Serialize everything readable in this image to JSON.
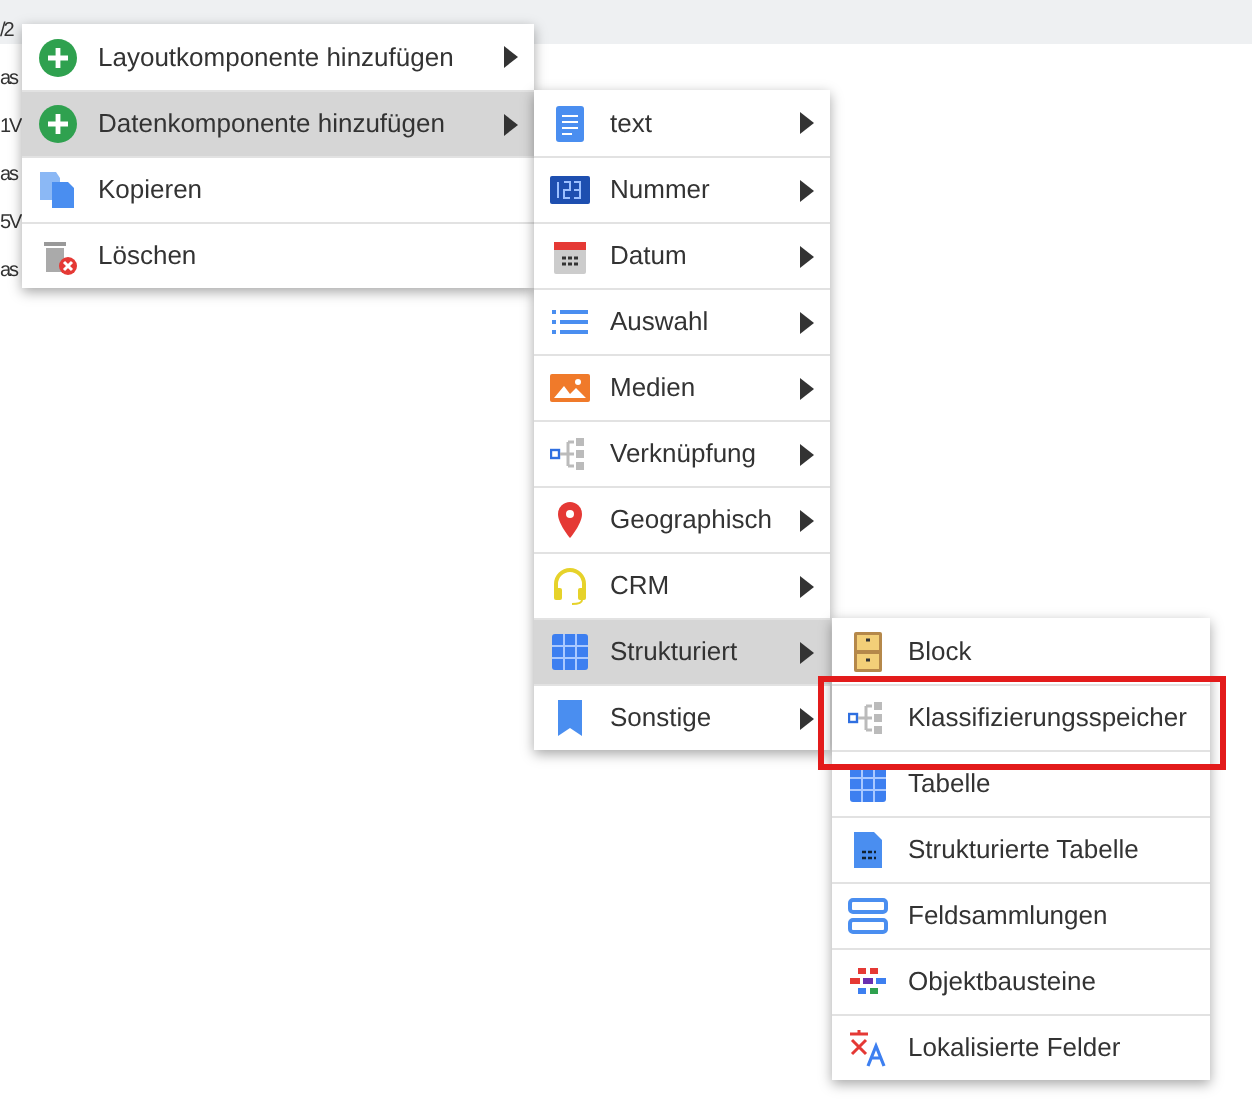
{
  "background_fragments": [
    "/2",
    "as",
    "1V",
    "as",
    "5V",
    "as"
  ],
  "context_menu": [
    {
      "label": "Layoutkomponente hinzufügen",
      "kind": "add",
      "selected": false,
      "submenu": true
    },
    {
      "label": "Datenkomponente hinzufügen",
      "kind": "add",
      "selected": true,
      "submenu": true
    },
    {
      "label": "Kopieren",
      "kind": "copy",
      "selected": false,
      "submenu": false
    },
    {
      "label": "Löschen",
      "kind": "delete",
      "selected": false,
      "submenu": false
    }
  ],
  "data_submenu": [
    {
      "label": "text",
      "kind": "doc",
      "selected": false,
      "submenu": true
    },
    {
      "label": "Nummer",
      "kind": "number",
      "selected": false,
      "submenu": true
    },
    {
      "label": "Datum",
      "kind": "calendar",
      "selected": false,
      "submenu": true
    },
    {
      "label": "Auswahl",
      "kind": "list",
      "selected": false,
      "submenu": true
    },
    {
      "label": "Medien",
      "kind": "image",
      "selected": false,
      "submenu": true
    },
    {
      "label": "Verknüpfung",
      "kind": "tree",
      "selected": false,
      "submenu": true
    },
    {
      "label": "Geographisch",
      "kind": "pin",
      "selected": false,
      "submenu": true
    },
    {
      "label": "CRM",
      "kind": "headset",
      "selected": false,
      "submenu": true
    },
    {
      "label": "Strukturiert",
      "kind": "grid",
      "selected": true,
      "submenu": true
    },
    {
      "label": "Sonstige",
      "kind": "bookmark",
      "selected": false,
      "submenu": true
    }
  ],
  "structured_submenu": [
    {
      "label": "Block",
      "kind": "drawer",
      "highlighted": false
    },
    {
      "label": "Klassifizierungsspeicher",
      "kind": "tree",
      "highlighted": true
    },
    {
      "label": "Tabelle",
      "kind": "grid",
      "highlighted": false
    },
    {
      "label": "Strukturierte Tabelle",
      "kind": "sheet",
      "highlighted": false
    },
    {
      "label": "Feldsammlungen",
      "kind": "fields",
      "highlighted": false
    },
    {
      "label": "Objektbausteine",
      "kind": "bricks",
      "highlighted": false
    },
    {
      "label": "Lokalisierte Felder",
      "kind": "translate",
      "highlighted": false
    }
  ]
}
